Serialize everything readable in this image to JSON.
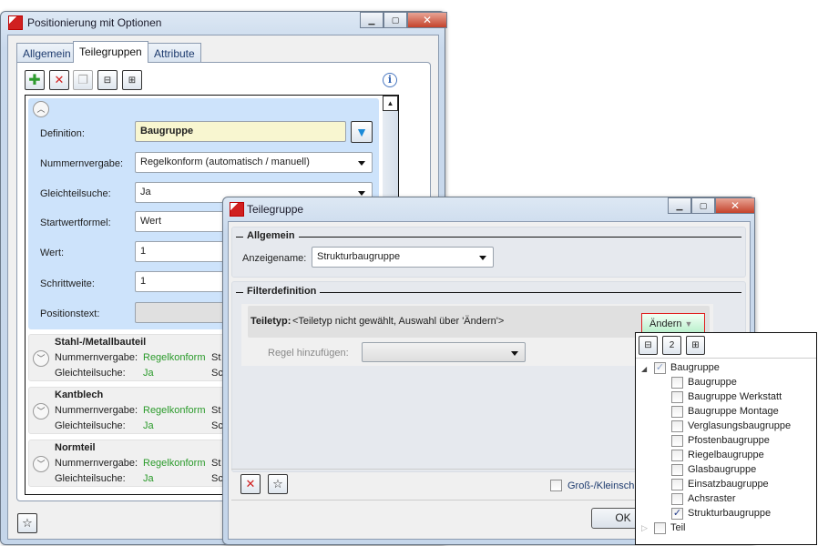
{
  "main_window": {
    "title": "Positionierung mit Optionen",
    "tabs": [
      "Allgemein",
      "Teilegruppen",
      "Attribute"
    ],
    "active_tab": "Teilegruppen",
    "toolbar": [
      "add-icon",
      "delete-icon",
      "copy-icon",
      "collapse-all-icon",
      "expand-all-icon"
    ],
    "form": {
      "definition_label": "Definition:",
      "definition_value": "Baugruppe",
      "nummernvergabe_label": "Nummernvergabe:",
      "nummernvergabe_value": "Regelkonform (automatisch / manuell)",
      "gleichteilsuche_label": "Gleichteilsuche:",
      "gleichteilsuche_value": "Ja",
      "startwertformel_label": "Startwertformel:",
      "startwertformel_value": "Wert",
      "wert_label": "Wert:",
      "wert_value": "1",
      "schrittweite_label": "Schrittweite:",
      "schrittweite_value": "1",
      "positionstext_label": "Positionstext:"
    },
    "groups": [
      {
        "name": "Stahl-/Metallbauteil",
        "k1": "Nummernvergabe:",
        "v1": "Regelkonform",
        "k2": "Gleichteilsuche:",
        "v2": "Ja",
        "c1": "St",
        "c2": "Sc"
      },
      {
        "name": "Kantblech",
        "k1": "Nummernvergabe:",
        "v1": "Regelkonform",
        "k2": "Gleichteilsuche:",
        "v2": "Ja",
        "c1": "St",
        "c2": "Sc"
      },
      {
        "name": "Normteil",
        "k1": "Nummernvergabe:",
        "v1": "Regelkonform",
        "k2": "Gleichteilsuche:",
        "v2": "Ja",
        "c1": "St",
        "c2": "Sc"
      }
    ]
  },
  "dialog": {
    "title": "Teilegruppe",
    "allgemein_heading": "Allgemein",
    "anzeigename_label": "Anzeigename:",
    "anzeigename_value": "Strukturbaugruppe",
    "filter_heading": "Filterdefinition",
    "teiletyp_label": "Teiletyp:",
    "teiletyp_value": "<Teiletyp nicht gewählt, Auswahl über 'Ändern'>",
    "aendern_label": "Ändern",
    "regel_label": "Regel hinzufügen:",
    "case_label": "Groß-/Kleinschr",
    "ok_label": "OK"
  },
  "dropdown": {
    "toolbar_labels": [
      "",
      "2",
      ""
    ],
    "parent": "Baugruppe",
    "children": [
      {
        "label": "Baugruppe",
        "checked": false
      },
      {
        "label": "Baugruppe Werkstatt",
        "checked": false
      },
      {
        "label": "Baugruppe Montage",
        "checked": false
      },
      {
        "label": "Verglasungsbaugruppe",
        "checked": false
      },
      {
        "label": "Pfostenbaugruppe",
        "checked": false
      },
      {
        "label": "Riegelbaugruppe",
        "checked": false
      },
      {
        "label": "Glasbaugruppe",
        "checked": false
      },
      {
        "label": "Einsatzbaugruppe",
        "checked": false
      },
      {
        "label": "Achsraster",
        "checked": false
      },
      {
        "label": "Strukturbaugruppe",
        "checked": true
      }
    ],
    "sibling": "Teil"
  }
}
